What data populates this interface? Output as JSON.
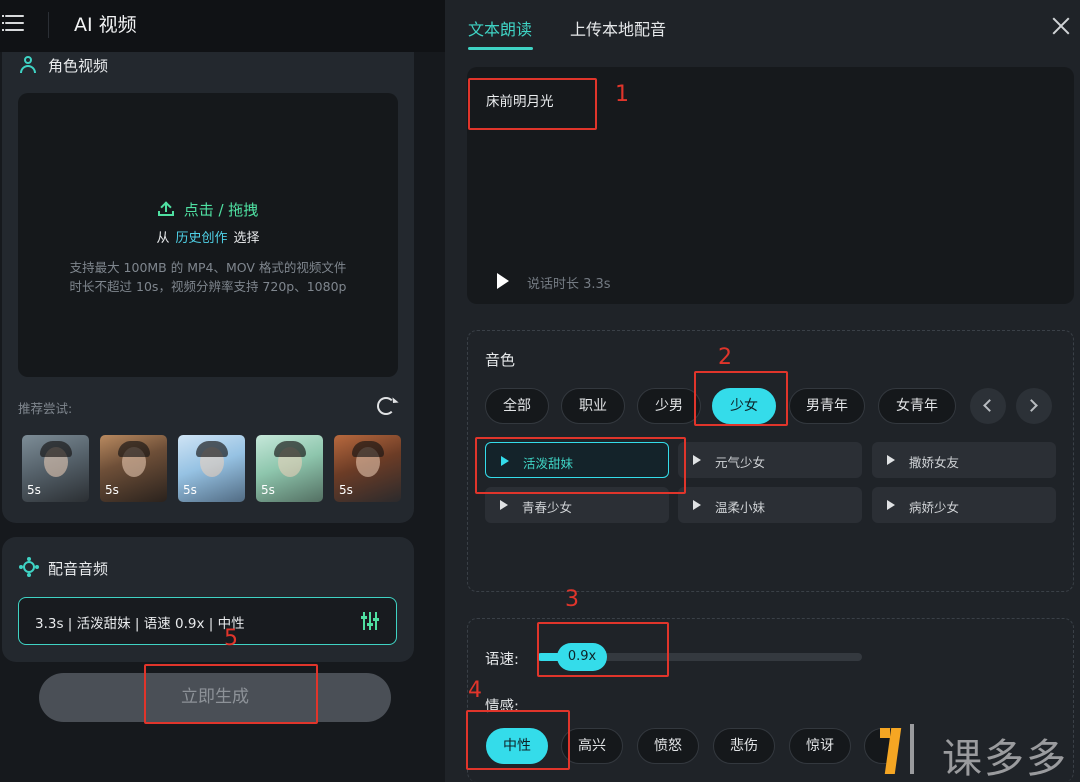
{
  "app": {
    "title": "AI 视频"
  },
  "role_video": {
    "title": "角色视频",
    "upload_action": "点击 / 拖拽",
    "from": "从",
    "history_link": "历史创作",
    "select": "选择",
    "hint_line1": "支持最大 100MB 的 MP4、MOV 格式的视频文件",
    "hint_line2": "时长不超过 10s，视频分辨率支持 720p、1080p",
    "recommend_label": "推荐尝试:",
    "thumbnails": [
      {
        "duration": "5s"
      },
      {
        "duration": "5s"
      },
      {
        "duration": "5s"
      },
      {
        "duration": "5s"
      },
      {
        "duration": "5s"
      }
    ]
  },
  "dubbing": {
    "title": "配音音频",
    "summary": "3.3s | 活泼甜妹 | 语速 0.9x | 中性"
  },
  "generate_button": "立即生成",
  "tabs": [
    {
      "label": "文本朗读",
      "active": true
    },
    {
      "label": "上传本地配音",
      "active": false
    }
  ],
  "text_reading": {
    "content": "床前明月光",
    "duration_label": "说话时长 3.3s"
  },
  "timbre": {
    "title": "音色",
    "categories": [
      {
        "label": "全部",
        "active": false
      },
      {
        "label": "职业",
        "active": false
      },
      {
        "label": "少男",
        "active": false
      },
      {
        "label": "少女",
        "active": true
      },
      {
        "label": "男青年",
        "active": false
      },
      {
        "label": "女青年",
        "active": false
      }
    ],
    "voices": [
      {
        "label": "活泼甜妹",
        "selected": true
      },
      {
        "label": "元气少女",
        "selected": false
      },
      {
        "label": "撒娇女友",
        "selected": false
      },
      {
        "label": "青春少女",
        "selected": false
      },
      {
        "label": "温柔小妹",
        "selected": false
      },
      {
        "label": "病娇少女",
        "selected": false
      }
    ]
  },
  "speed": {
    "label": "语速:",
    "value": "0.9x",
    "fill_fraction": 0.18
  },
  "emotion": {
    "label": "情感:",
    "options": [
      {
        "label": "中性",
        "active": true
      },
      {
        "label": "高兴",
        "active": false
      },
      {
        "label": "愤怒",
        "active": false
      },
      {
        "label": "悲伤",
        "active": false
      },
      {
        "label": "惊讶",
        "active": false
      }
    ]
  },
  "annotations": [
    "1",
    "2",
    "3",
    "4",
    "5"
  ],
  "colors": {
    "accent": "#34dcea",
    "green": "#4fe0a2",
    "annotation": "#e0352b"
  }
}
